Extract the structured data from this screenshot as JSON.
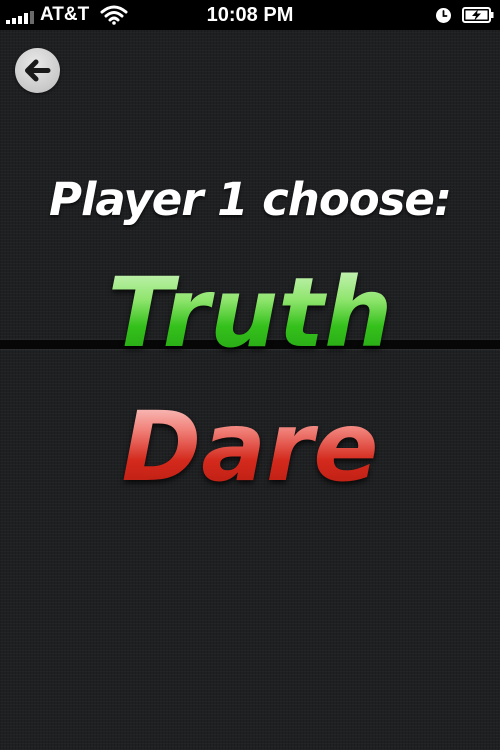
{
  "status_bar": {
    "carrier": "AT&T",
    "time": "10:08 PM",
    "icons": [
      "signal-bars-icon",
      "wifi-icon",
      "alarm-clock-icon",
      "battery-charging-icon"
    ]
  },
  "navigation": {
    "back_icon": "back-arrow-icon"
  },
  "prompt": {
    "text": "Player 1 choose:"
  },
  "options": {
    "truth_label": "Truth",
    "dare_label": "Dare"
  },
  "colors": {
    "background": "#1f2022",
    "status_bar": "#000000",
    "truth_green": "#35c11c",
    "dare_red": "#d42a1d",
    "prompt_text": "#ffffff"
  }
}
